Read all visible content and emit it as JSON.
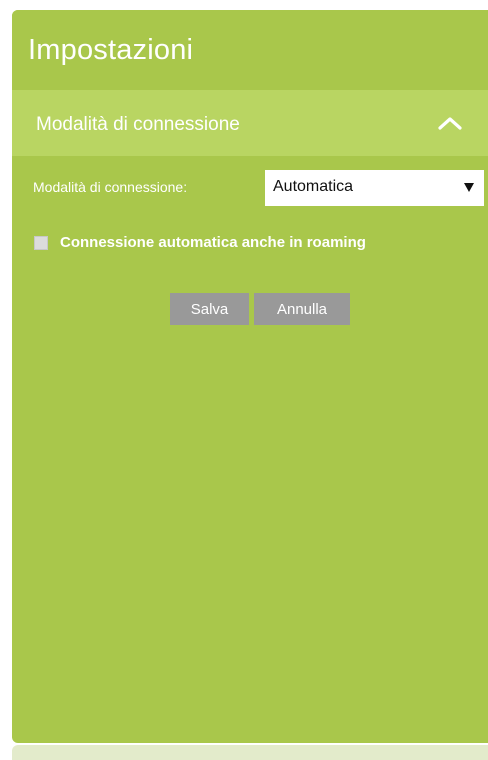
{
  "header": {
    "title": "Impostazioni"
  },
  "section": {
    "title": "Modalità di connessione",
    "expanded": true,
    "toggle_icon": "chevron-up-icon"
  },
  "form": {
    "connection_mode_label": "Modalità di connessione:",
    "connection_mode_value": "Automatica",
    "roaming_checkbox_label": "Connessione automatica anche in roaming",
    "roaming_checked": false
  },
  "buttons": {
    "save_label": "Salva",
    "cancel_label": "Annulla"
  },
  "colors": {
    "panel_green": "#a9c74b",
    "section_green": "#b9d562",
    "button_gray": "#999999"
  }
}
